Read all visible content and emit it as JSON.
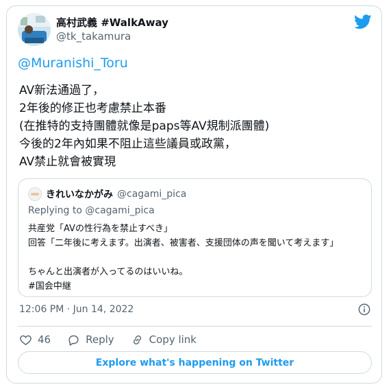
{
  "tweet": {
    "author": {
      "display_name": "高村武義 #WalkAway",
      "handle": "@tk_takamura"
    },
    "mention": "@Muranishi_Toru",
    "lines": [
      "AV新法通過了，",
      "2年後的修正也考慮禁止本番",
      "(在推特的支持團體就像是paps等AV規制派團體)",
      "今後的2年內如果不阻止這些議員或政黨，",
      "AV禁止就會被實現"
    ],
    "timestamp": "12:06 PM · Jun 14, 2022"
  },
  "quoted_tweet": {
    "display_name": "きれいなかがみ",
    "handle": "@cagami_pica",
    "replying_to": "Replying to @cagami_pica",
    "lines": [
      "共産党「AVの性行為を禁止すべき」",
      "回答「二年後に考えます。出演者、被害者、支援団体の声を聞いて考えます」",
      "",
      "ちゃんと出演者が入ってるのはいいね。",
      "#国会中継"
    ]
  },
  "actions": {
    "likes_count": "46",
    "reply_label": "Reply",
    "copy_label": "Copy link"
  },
  "explore_label": "Explore what's happening on Twitter",
  "icons": [
    "twitter-bird-icon",
    "info-icon",
    "heart-icon",
    "reply-icon",
    "link-icon"
  ],
  "colors": {
    "accent": "#1d9bf0",
    "secondary_text": "#536471",
    "border": "#cfd9de"
  }
}
